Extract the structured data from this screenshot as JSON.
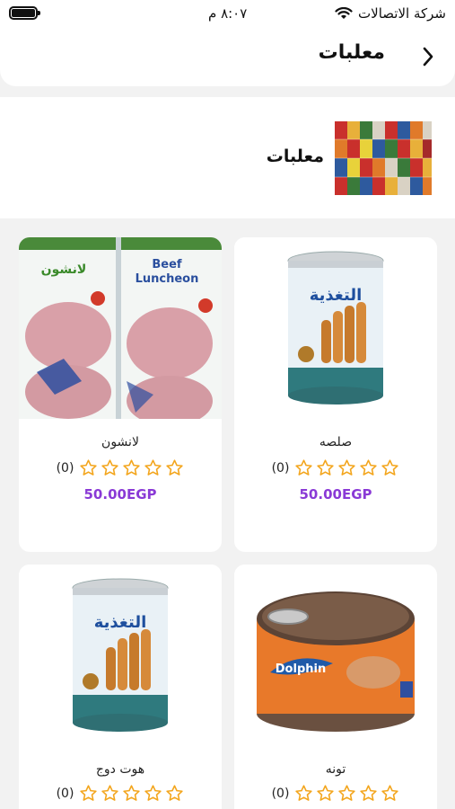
{
  "status_bar": {
    "carrier": "شركة الاتصالات",
    "time": "٨:٠٧ م"
  },
  "header": {
    "title": "معلبات",
    "back_icon": "chevron-left-icon"
  },
  "category": {
    "name": "معلبات",
    "image_icon": "canned-goods-image"
  },
  "colors": {
    "price": "#8a3ad6",
    "star": "#f3a51c"
  },
  "products": [
    {
      "name": "صلصه",
      "rating": 0,
      "rating_label": "(0)",
      "price": "50.00EGP",
      "image": "canned-hotdog-image"
    },
    {
      "name": "لانشون",
      "rating": 0,
      "rating_label": "(0)",
      "price": "50.00EGP",
      "image": "beef-luncheon-image"
    },
    {
      "name": "تونه",
      "rating": 0,
      "rating_label": "(0)",
      "price": "",
      "image": "dolphin-tuna-can-image"
    },
    {
      "name": "هوت دوج",
      "rating": 0,
      "rating_label": "(0)",
      "price": "",
      "image": "canned-hotdog-image"
    }
  ]
}
